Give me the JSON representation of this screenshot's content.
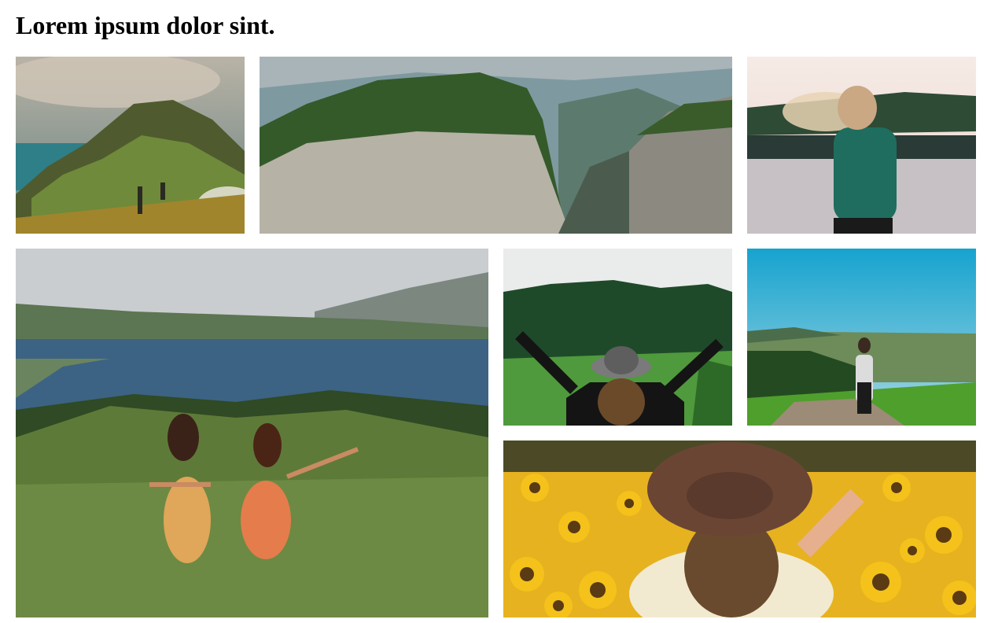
{
  "page": {
    "title": "Lorem ipsum dolor sint."
  },
  "gallery": {
    "photos": [
      {
        "subject": "mountain-ridge-hikers"
      },
      {
        "subject": "canyon-cliffs"
      },
      {
        "subject": "woman-by-lake"
      },
      {
        "subject": "two-women-on-hill-by-bay"
      },
      {
        "subject": "woman-with-hat-raising-arms"
      },
      {
        "subject": "man-overlooking-valley"
      },
      {
        "subject": "woman-in-sunflower-field"
      }
    ]
  },
  "colors": {
    "background": "#ffffff",
    "text": "#000000"
  }
}
